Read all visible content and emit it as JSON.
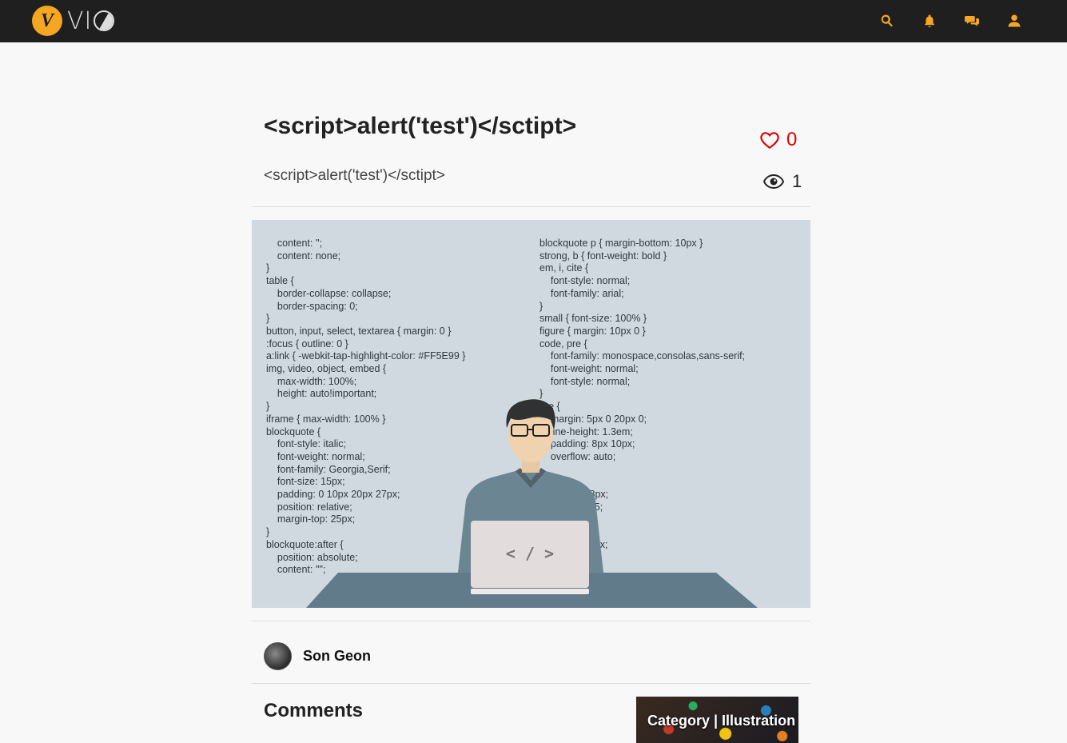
{
  "header": {
    "logo_letter": "V",
    "logo_text": "VI",
    "icons": [
      "search-icon",
      "bell-icon",
      "chat-icon",
      "user-icon"
    ],
    "accent_color": "#f5a623"
  },
  "post": {
    "title": "<script>alert('test')</sctipt>",
    "subtitle": "<script>alert('test')</sctipt>",
    "likes": "0",
    "views": "1"
  },
  "hero": {
    "code_left": "    content: '';\n    content: none;\n}\ntable {\n    border-collapse: collapse;\n    border-spacing: 0;\n}\nbutton, input, select, textarea { margin: 0 }\n:focus { outline: 0 }\na:link { -webkit-tap-highlight-color: #FF5E99 }\nimg, video, object, embed {\n    max-width: 100%;\n    height: auto!important;\n}\niframe { max-width: 100% }\nblockquote {\n    font-style: italic;\n    font-weight: normal;\n    font-family: Georgia,Serif;\n    font-size: 15px;\n    padding: 0 10px 20px 27px;\n    position: relative;\n    margin-top: 25px;\n}\nblockquote:after {\n    position: absolute;\n    content: '\"';",
    "code_right": "blockquote p { margin-bottom: 10px }\nstrong, b { font-weight: bold }\nem, i, cite {\n    font-style: normal;\n    font-family: arial;\n}\nsmall { font-size: 100% }\nfigure { margin: 10px 0 }\ncode, pre {\n    font-family: monospace,consolas,sans-serif;\n    font-weight: normal;\n    font-style: normal;\n}\npre {\n    margin: 5px 0 20px 0;\n    line-height: 1.3em;\n    padding: 8px 10px;\n    overflow: auto;\n\n         {\n         ng: 0 8px;\n         ight: 1.5;\n\n\n         : 1px 6px;\n         0 2px;\n         black;",
    "laptop_symbol": "< / >"
  },
  "author": {
    "name": "Son Geon"
  },
  "comments": {
    "title": "Comments"
  },
  "category": {
    "label": "Category | Illustration"
  }
}
